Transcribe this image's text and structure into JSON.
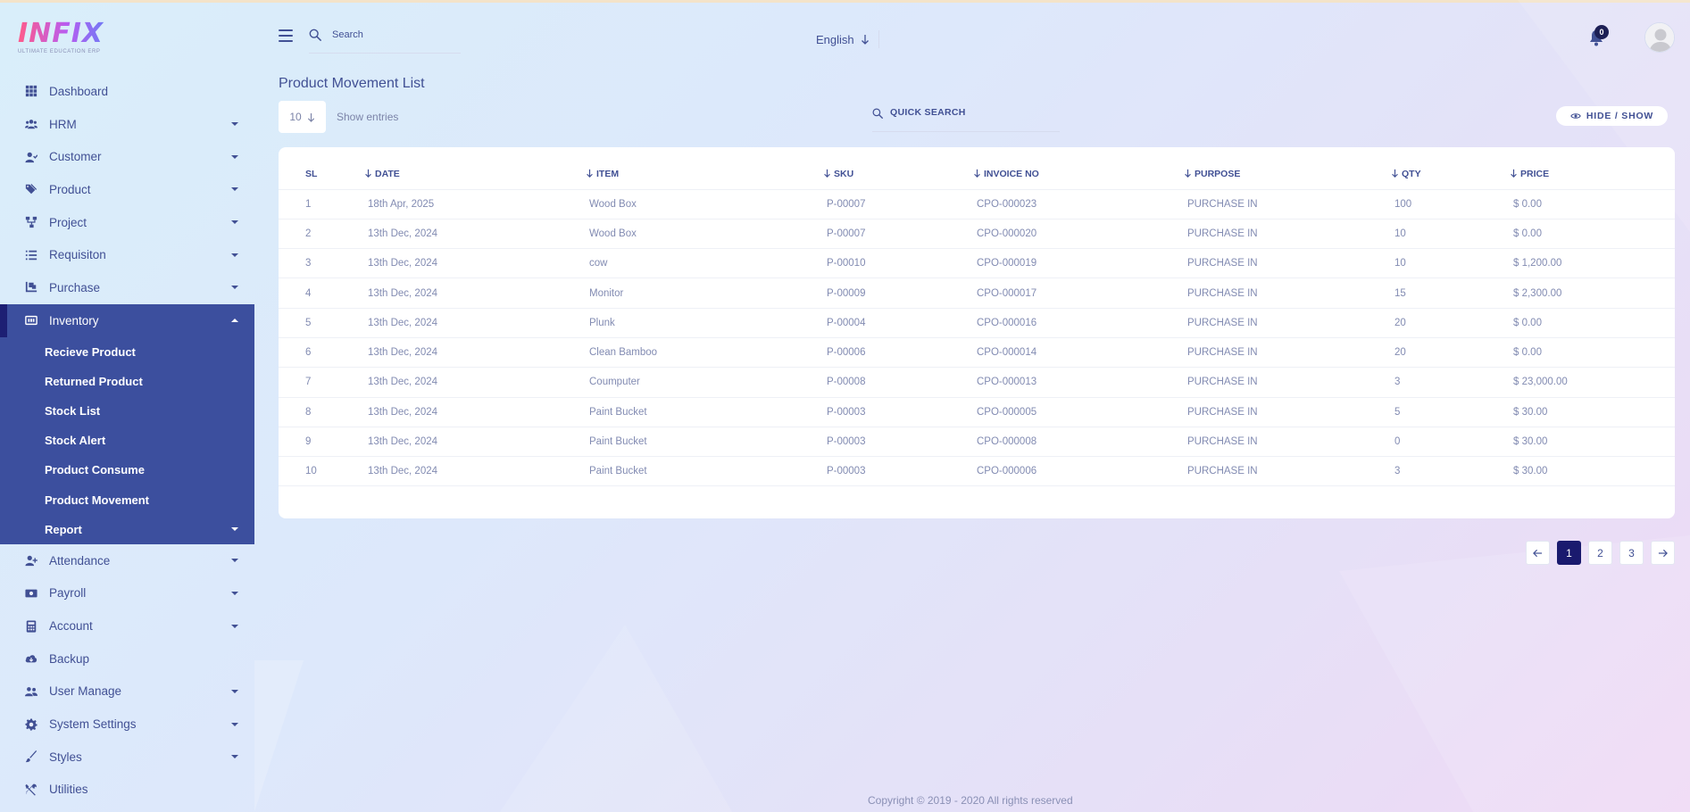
{
  "brand": {
    "logo_text": "INFIX",
    "logo_subtitle": "ULTIMATE EDUCATION ERP"
  },
  "header": {
    "search_placeholder": "Search",
    "language": "English",
    "notification_count": "0"
  },
  "sidebar": {
    "items": [
      {
        "label": "Dashboard",
        "icon": "dashboard-icon",
        "caret": false
      },
      {
        "label": "HRM",
        "icon": "hrm-icon",
        "caret": true
      },
      {
        "label": "Customer",
        "icon": "customer-icon",
        "caret": true
      },
      {
        "label": "Product",
        "icon": "tag-icon",
        "caret": true
      },
      {
        "label": "Project",
        "icon": "project-icon",
        "caret": true
      },
      {
        "label": "Requisiton",
        "icon": "list-icon",
        "caret": true
      },
      {
        "label": "Purchase",
        "icon": "purchase-icon",
        "caret": true
      }
    ],
    "open_section": {
      "label": "Inventory",
      "icon": "inventory-icon",
      "children": [
        {
          "label": "Recieve Product"
        },
        {
          "label": "Returned Product"
        },
        {
          "label": "Stock List"
        },
        {
          "label": "Stock Alert"
        },
        {
          "label": "Product Consume"
        },
        {
          "label": "Product Movement"
        },
        {
          "label": "Report",
          "caret": true
        }
      ]
    },
    "items_after": [
      {
        "label": "Attendance",
        "icon": "attendance-icon",
        "caret": true
      },
      {
        "label": "Payroll",
        "icon": "payroll-icon",
        "caret": true
      },
      {
        "label": "Account",
        "icon": "calculator-icon",
        "caret": true
      },
      {
        "label": "Backup",
        "icon": "cloud-download-icon",
        "caret": false
      },
      {
        "label": "User Manage",
        "icon": "users-icon",
        "caret": true
      },
      {
        "label": "System Settings",
        "icon": "gear-icon",
        "caret": true
      },
      {
        "label": "Styles",
        "icon": "brush-icon",
        "caret": true
      },
      {
        "label": "Utilities",
        "icon": "tools-icon",
        "caret": false
      }
    ]
  },
  "main": {
    "title": "Product Movement List",
    "entries_value": "10",
    "entries_label": "Show entries",
    "quick_search_label": "QUICK SEARCH",
    "hide_show_label": "HIDE / SHOW",
    "table": {
      "columns": [
        "SL",
        "DATE",
        "ITEM",
        "SKU",
        "INVOICE NO",
        "PURPOSE",
        "QTY",
        "PRICE"
      ],
      "rows": [
        [
          "1",
          "18th Apr, 2025",
          "Wood Box",
          "P-00007",
          "CPO-000023",
          "PURCHASE IN",
          "100",
          "$ 0.00"
        ],
        [
          "2",
          "13th Dec, 2024",
          "Wood Box",
          "P-00007",
          "CPO-000020",
          "PURCHASE IN",
          "10",
          "$ 0.00"
        ],
        [
          "3",
          "13th Dec, 2024",
          "cow",
          "P-00010",
          "CPO-000019",
          "PURCHASE IN",
          "10",
          "$ 1,200.00"
        ],
        [
          "4",
          "13th Dec, 2024",
          "Monitor",
          "P-00009",
          "CPO-000017",
          "PURCHASE IN",
          "15",
          "$ 2,300.00"
        ],
        [
          "5",
          "13th Dec, 2024",
          "Plunk",
          "P-00004",
          "CPO-000016",
          "PURCHASE IN",
          "20",
          "$ 0.00"
        ],
        [
          "6",
          "13th Dec, 2024",
          "Clean Bamboo",
          "P-00006",
          "CPO-000014",
          "PURCHASE IN",
          "20",
          "$ 0.00"
        ],
        [
          "7",
          "13th Dec, 2024",
          "Coumputer",
          "P-00008",
          "CPO-000013",
          "PURCHASE IN",
          "3",
          "$ 23,000.00"
        ],
        [
          "8",
          "13th Dec, 2024",
          "Paint Bucket",
          "P-00003",
          "CPO-000005",
          "PURCHASE IN",
          "5",
          "$ 30.00"
        ],
        [
          "9",
          "13th Dec, 2024",
          "Paint Bucket",
          "P-00003",
          "CPO-000008",
          "PURCHASE IN",
          "0",
          "$ 30.00"
        ],
        [
          "10",
          "13th Dec, 2024",
          "Paint Bucket",
          "P-00003",
          "CPO-000006",
          "PURCHASE IN",
          "3",
          "$ 30.00"
        ]
      ]
    },
    "pagination": {
      "pages": [
        "1",
        "2",
        "3"
      ],
      "active": "1"
    }
  },
  "footer": {
    "text": "Copyright © 2019 - 2020 All rights reserved"
  },
  "colors": {
    "primary": "#415094",
    "sidebar_active": "#3c4f9e",
    "accent_dark": "#1a1a6e"
  }
}
